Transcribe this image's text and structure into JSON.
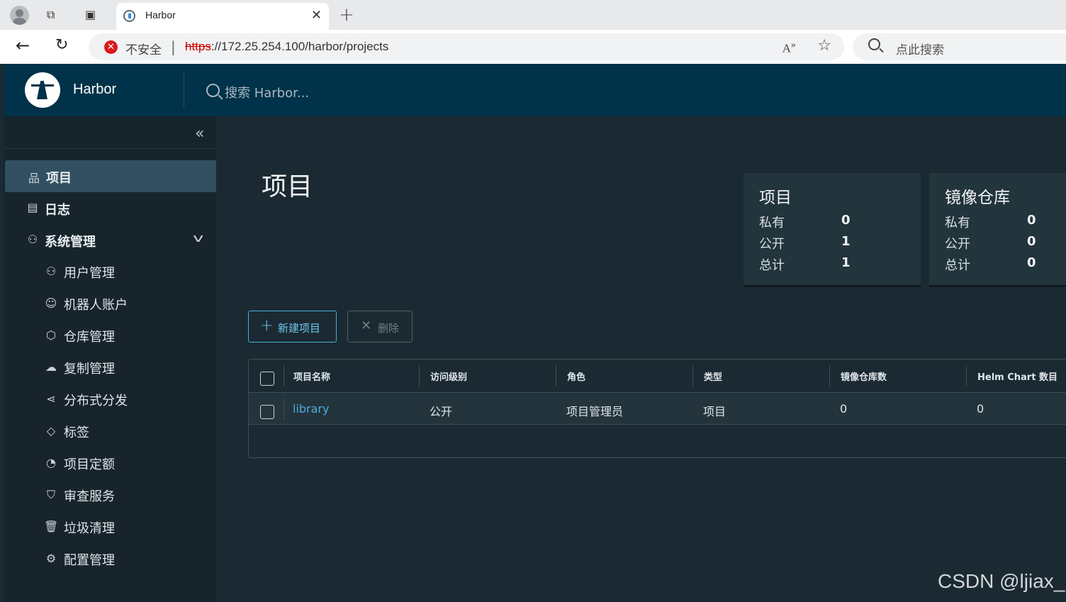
{
  "browser": {
    "tab_title": "Harbor",
    "security_label": "不安全",
    "url_scheme": "https",
    "url_rest": "://172.25.254.100/harbor/projects",
    "search_placeholder": "点此搜索"
  },
  "header": {
    "brand": "Harbor",
    "search_placeholder": "搜索 Harbor..."
  },
  "sidebar": {
    "items": [
      {
        "label": "项目",
        "icon": "project-icon",
        "active": true
      },
      {
        "label": "日志",
        "icon": "log-icon"
      },
      {
        "label": "系统管理",
        "icon": "admin-icon",
        "expanded": true
      }
    ],
    "sub_items": [
      {
        "label": "用户管理",
        "icon": "users-icon"
      },
      {
        "label": "机器人账户",
        "icon": "robot-icon"
      },
      {
        "label": "仓库管理",
        "icon": "registry-icon"
      },
      {
        "label": "复制管理",
        "icon": "replication-icon"
      },
      {
        "label": "分布式分发",
        "icon": "distribution-icon"
      },
      {
        "label": "标签",
        "icon": "tag-icon"
      },
      {
        "label": "项目定额",
        "icon": "quota-icon"
      },
      {
        "label": "审查服务",
        "icon": "shield-icon"
      },
      {
        "label": "垃圾清理",
        "icon": "trash-icon"
      },
      {
        "label": "配置管理",
        "icon": "gear-icon"
      }
    ]
  },
  "main": {
    "title": "项目",
    "cards": [
      {
        "title": "项目",
        "rows": [
          {
            "label": "私有",
            "value": "0"
          },
          {
            "label": "公开",
            "value": "1"
          },
          {
            "label": "总计",
            "value": "1"
          }
        ]
      },
      {
        "title": "镜像仓库",
        "rows": [
          {
            "label": "私有",
            "value": "0"
          },
          {
            "label": "公开",
            "value": "0"
          },
          {
            "label": "总计",
            "value": "0"
          }
        ]
      }
    ],
    "new_button": "新建项目",
    "delete_button": "删除",
    "table": {
      "headers": [
        "项目名称",
        "访问级别",
        "角色",
        "类型",
        "镜像仓库数",
        "Helm Chart 数目"
      ],
      "rows": [
        [
          "library",
          "公开",
          "项目管理员",
          "项目",
          "0",
          "0"
        ]
      ]
    }
  },
  "watermark": "CSDN @ljiax_"
}
